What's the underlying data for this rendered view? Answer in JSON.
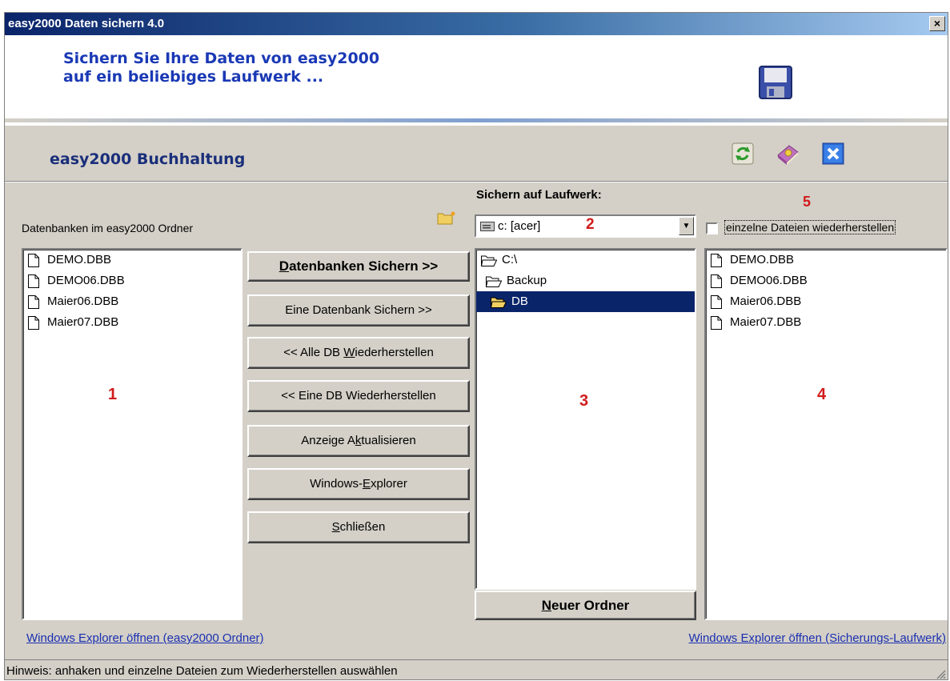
{
  "window": {
    "title": "easy2000 Daten sichern 4.0",
    "close_label": "×"
  },
  "banner": {
    "line1": "Sichern Sie Ihre Daten von easy2000",
    "line2": "auf ein beliebiges Laufwerk ..."
  },
  "section": {
    "title": "easy2000 Buchhaltung"
  },
  "toolbar_icons": [
    "refresh-icon",
    "help-book-icon",
    "close-icon"
  ],
  "left_panel": {
    "label": "Datenbanken im easy2000 Ordner",
    "files": [
      "DEMO.DBB",
      "DEMO06.DBB",
      "Maier06.DBB",
      "Maier07.DBB"
    ],
    "marker": "1"
  },
  "buttons": {
    "backup_all": {
      "pre": "",
      "ul": "D",
      "post": "atenbanken Sichern >>"
    },
    "backup_one": {
      "pre": "Eine Datenbank Sichern >>",
      "ul": "",
      "post": ""
    },
    "restore_all": {
      "pre": "<< Alle DB ",
      "ul": "W",
      "post": "iederherstellen"
    },
    "restore_one": {
      "pre": "<< Eine DB Wiederherstellen",
      "ul": "",
      "post": ""
    },
    "refresh": {
      "pre": "Anzeige A",
      "ul": "k",
      "post": "tualisieren"
    },
    "explorer": {
      "pre": "Windows-",
      "ul": "E",
      "post": "xplorer"
    },
    "close": {
      "pre": "",
      "ul": "S",
      "post": "chließen"
    },
    "new_folder": {
      "pre": "",
      "ul": "N",
      "post": "euer Ordner"
    }
  },
  "drive": {
    "label": "Sichern auf Laufwerk:",
    "selected": "c: [acer]",
    "marker": "2"
  },
  "tree": {
    "items": [
      {
        "name": "C:\\",
        "indent": 0,
        "selected": false
      },
      {
        "name": "Backup",
        "indent": 1,
        "selected": false
      },
      {
        "name": "DB",
        "indent": 2,
        "selected": true
      }
    ],
    "marker": "3"
  },
  "right_panel": {
    "checkbox_label": "einzelne Dateien wiederherstellen",
    "checkbox_checked": false,
    "files": [
      "DEMO.DBB",
      "DEMO06.DBB",
      "Maier06.DBB",
      "Maier07.DBB"
    ],
    "marker_list": "4",
    "marker_checkbox": "5"
  },
  "links": {
    "left": "Windows Explorer öffnen (easy2000 Ordner)",
    "right": "Windows Explorer öffnen (Sicherungs-Laufwerk)"
  },
  "status": {
    "text": "Hinweis: anhaken und einzelne Dateien zum Wiederherstellen auswählen"
  },
  "colors": {
    "title_blue": "#0a246a",
    "accent_blue": "#1a39b5",
    "marker_red": "#d11b1b",
    "face": "#d4d0c8"
  }
}
